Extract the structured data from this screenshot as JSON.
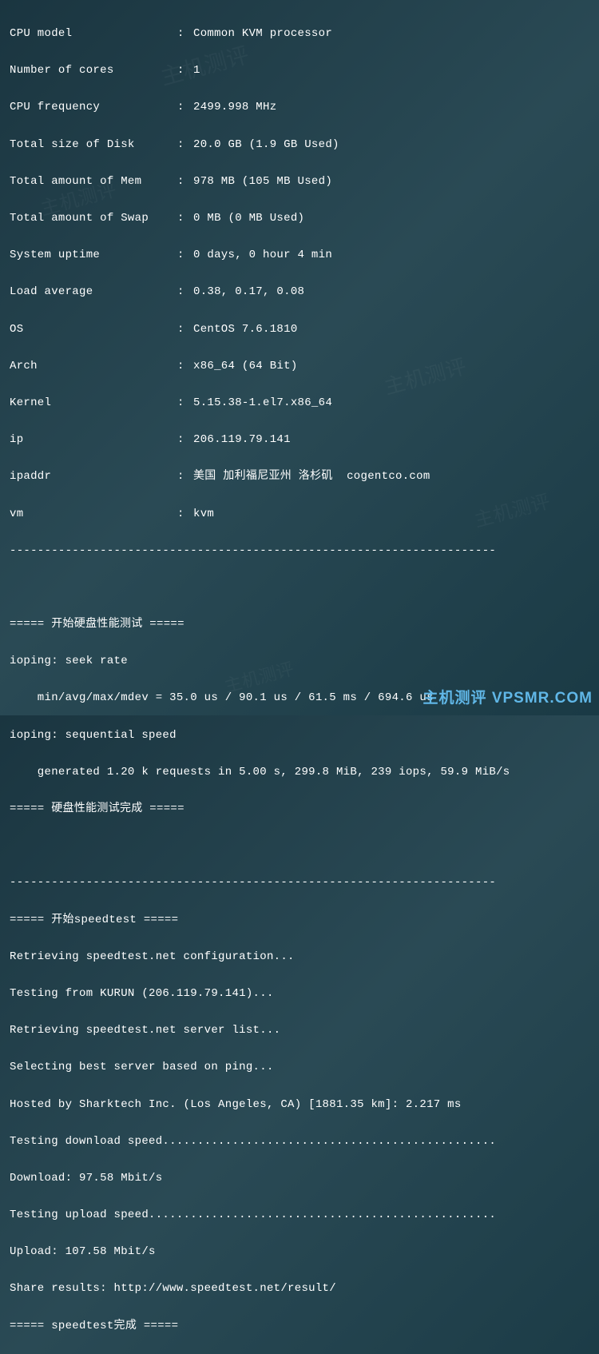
{
  "sysinfo": {
    "cpu_model_label": "CPU model",
    "cpu_model_value": "Common KVM processor",
    "cores_label": "Number of cores",
    "cores_value": "1",
    "cpu_freq_label": "CPU frequency",
    "cpu_freq_value": "2499.998 MHz",
    "disk_label": "Total size of Disk",
    "disk_value": "20.0 GB (1.9 GB Used)",
    "mem_label": "Total amount of Mem",
    "mem_value": "978 MB (105 MB Used)",
    "swap_label": "Total amount of Swap",
    "swap_value": "0 MB (0 MB Used)",
    "uptime_label": "System uptime",
    "uptime_value": "0 days, 0 hour 4 min",
    "load_label": "Load average",
    "load_value": "0.38, 0.17, 0.08",
    "os_label": "OS",
    "os_value": "CentOS 7.6.1810",
    "arch_label": "Arch",
    "arch_value": "x86_64 (64 Bit)",
    "kernel_label": "Kernel",
    "kernel_value": "5.15.38-1.el7.x86_64",
    "ip_label": "ip",
    "ip_value": "206.119.79.141",
    "ipaddr_label": "ipaddr",
    "ipaddr_value": "美国 加利福尼亚州 洛杉矶  cogentco.com",
    "vm_label": "vm",
    "vm_value": "kvm"
  },
  "divider": "----------------------------------------------------------------------",
  "disktest": {
    "header": "===== 开始硬盘性能测试 =====",
    "seek_label": "ioping: seek rate",
    "seek_result": "    min/avg/max/mdev = 35.0 us / 90.1 us / 61.5 ms / 694.6 us",
    "seq_label": "ioping: sequential speed",
    "seq_result": "    generated 1.20 k requests in 5.00 s, 299.8 MiB, 239 iops, 59.9 MiB/s",
    "footer": "===== 硬盘性能测试完成 ====="
  },
  "speedtest": {
    "header": "===== 开始speedtest =====",
    "line1": "Retrieving speedtest.net configuration...",
    "line2": "Testing from KURUN (206.119.79.141)...",
    "line3": "Retrieving speedtest.net server list...",
    "line4": "Selecting best server based on ping...",
    "line5": "Hosted by Sharktech Inc. (Los Angeles, CA) [1881.35 km]: 2.217 ms",
    "line6": "Testing download speed................................................",
    "download": "Download: 97.58 Mbit/s",
    "line7": "Testing upload speed..................................................",
    "upload": "Upload: 107.58 Mbit/s",
    "share": "Share results: http://www.speedtest.net/result/",
    "footer": "===== speedtest完成 ====="
  },
  "branding": {
    "footer_text": "主机测评 VPSMR.COM",
    "wm_text": "主机测评"
  }
}
